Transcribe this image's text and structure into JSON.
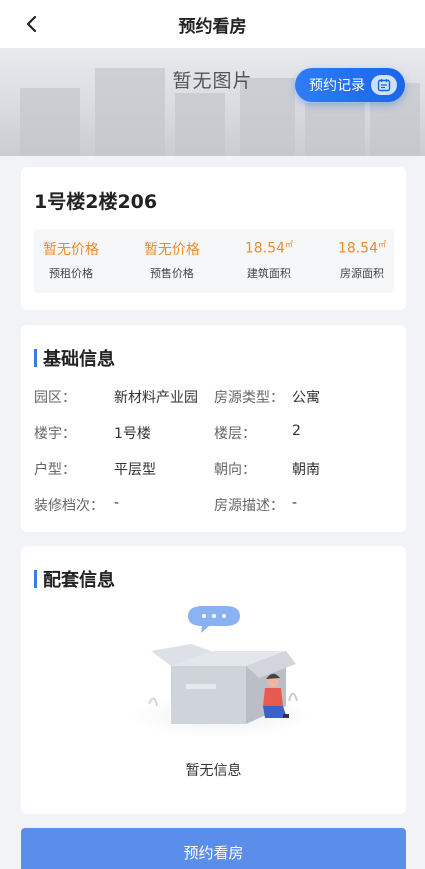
{
  "nav": {
    "title": "预约看房"
  },
  "hero": {
    "placeholder_text": "暂无图片",
    "record_button_label": "预约记录"
  },
  "unit": {
    "title": "1号楼2楼206",
    "prices": [
      {
        "value": "暂无价格",
        "unit": "",
        "label": "预租价格"
      },
      {
        "value": "暂无价格",
        "unit": "",
        "label": "预售价格"
      },
      {
        "value": "18.54",
        "unit": "㎡",
        "label": "建筑面积"
      },
      {
        "value": "18.54",
        "unit": "㎡",
        "label": "房源面积"
      }
    ]
  },
  "basic": {
    "title": "基础信息",
    "rows": [
      {
        "l1": "园区：",
        "v1": "新材料产业园",
        "l2": "房源类型：",
        "v2": "公寓"
      },
      {
        "l1": "楼宇：",
        "v1": "1号楼",
        "l2": "楼层：",
        "v2": "2"
      },
      {
        "l1": "户型：",
        "v1": "平层型",
        "l2": "朝向：",
        "v2": "朝南"
      },
      {
        "l1": "装修档次：",
        "v1": "-",
        "l2": "房源描述：",
        "v2": "-"
      }
    ]
  },
  "facilities": {
    "title": "配套信息",
    "empty_text": "暂无信息"
  },
  "footer": {
    "button_label": "预约看房"
  },
  "colors": {
    "accent": "#1a66e8",
    "price": "#f28a2b",
    "button": "#5b8eea"
  }
}
